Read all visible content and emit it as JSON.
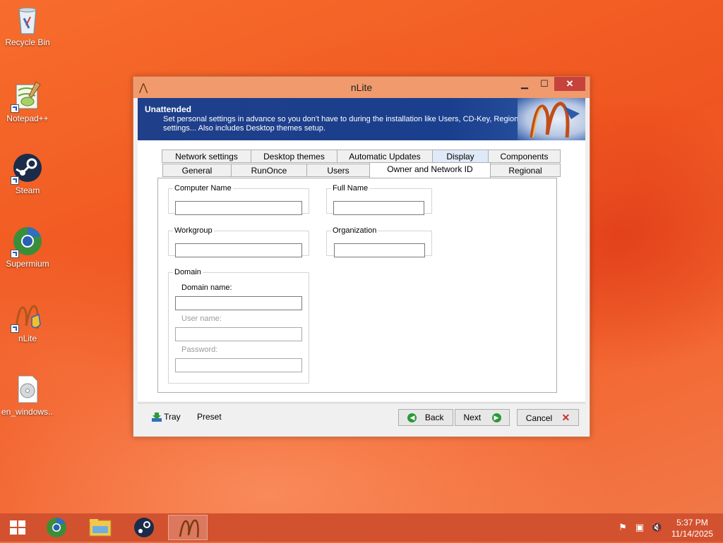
{
  "desktop": {
    "icons": [
      {
        "label": "Recycle Bin",
        "icon": "recycle-bin-icon"
      },
      {
        "label": "Notepad++",
        "icon": "notepad-plus-plus-icon"
      },
      {
        "label": "Steam",
        "icon": "steam-icon"
      },
      {
        "label": "Supermium",
        "icon": "supermium-icon"
      },
      {
        "label": "nLite",
        "icon": "nlite-icon"
      },
      {
        "label": "en_windows...",
        "icon": "disc-image-icon"
      }
    ]
  },
  "window": {
    "title": "nLite",
    "controls": {
      "minimize": "▁",
      "maximize": "☐",
      "close": "✕"
    },
    "banner": {
      "heading": "Unattended",
      "description": "Set personal settings in advance so you don't have to during the installation like Users, CD-Key, Regional settings... Also includes Desktop themes setup."
    },
    "tabs_row1": [
      "Network settings",
      "Desktop themes",
      "Automatic Updates",
      "Display",
      "Components"
    ],
    "tabs_row2": [
      "General",
      "RunOnce",
      "Users",
      "Owner and Network ID",
      "Regional"
    ],
    "active_tab": "Owner and Network ID",
    "form": {
      "computer_name": {
        "label": "Computer Name",
        "value": ""
      },
      "full_name": {
        "label": "Full Name",
        "value": ""
      },
      "workgroup": {
        "label": "Workgroup",
        "value": ""
      },
      "organization": {
        "label": "Organization",
        "value": ""
      },
      "domain": {
        "label": "Domain",
        "domain_name": {
          "label": "Domain name:",
          "value": ""
        },
        "user_name": {
          "label": "User name:",
          "value": ""
        },
        "password": {
          "label": "Password:",
          "value": ""
        }
      }
    },
    "footer": {
      "tray": "Tray",
      "preset": "Preset",
      "back": "Back",
      "next": "Next",
      "cancel": "Cancel"
    }
  },
  "taskbar": {
    "apps": [
      "supermium-icon",
      "file-explorer-icon",
      "steam-icon",
      "nlite-icon"
    ],
    "active_app": "nlite-icon",
    "tray_icons": [
      "action-center-flag-icon",
      "network-icon",
      "volume-muted-icon"
    ],
    "time": "5:37 PM",
    "date": "11/14/2025"
  },
  "colors": {
    "desktop": "#ef5a22",
    "banner": "#1f3f8a",
    "taskbar": "#d25230",
    "close_button": "#c7423a"
  }
}
